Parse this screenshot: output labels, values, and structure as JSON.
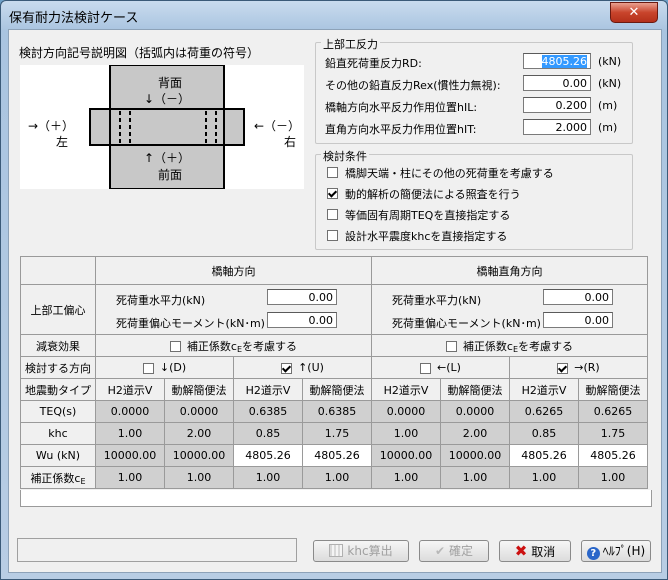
{
  "window": {
    "title": "保有耐力法検討ケース",
    "close_glyph": "✕"
  },
  "diagram": {
    "caption": "検討方向記号説明図（括弧内は荷重の符号）",
    "top_label": "背面",
    "top_arrow": "↓（－）",
    "bottom_arrow": "↑（＋）",
    "bottom_label": "前面",
    "left_arrow": "→（＋）",
    "left_label": "左",
    "right_arrow": "←（－）",
    "right_label": "右"
  },
  "reaction": {
    "title": "上部工反力",
    "rows": [
      {
        "label": "鉛直死荷重反力RD:",
        "value": "4805.26",
        "unit": "(kN)"
      },
      {
        "label": "その他の鉛直反力Rex(慣性力無視):",
        "value": "0.00",
        "unit": "(kN)"
      },
      {
        "label": "橋軸方向水平反力作用位置hIL:",
        "value": "0.200",
        "unit": "(m)"
      },
      {
        "label": "直角方向水平反力作用位置hIT:",
        "value": "2.000",
        "unit": "(m)"
      }
    ]
  },
  "conditions": {
    "title": "検討条件",
    "items": [
      {
        "label": "橋脚天端・柱にその他の死荷重を考慮する",
        "checked": false
      },
      {
        "label": "動的解析の簡便法による照査を行う",
        "checked": true
      },
      {
        "label": "等価固有周期TEQを直接指定する",
        "checked": false
      },
      {
        "label": "設計水平震度khcを直接指定する",
        "checked": false
      }
    ]
  },
  "grid": {
    "head_axis": "橋軸方向",
    "head_perp": "橋軸直角方向",
    "ecc_label": "上部工偏心",
    "ecc_h_label": "死荷重水平力(kN)",
    "ecc_m_label": "死荷重偏心モーメント(kN･m)",
    "ecc_axis_h": "0.00",
    "ecc_axis_m": "0.00",
    "ecc_perp_h": "0.00",
    "ecc_perp_m": "0.00",
    "damp_label": "減衰効果",
    "damp_axis_text": "補正係数c",
    "damp_perp_text": "補正係数c",
    "damp_sub": "E",
    "damp_suffix": "を考慮する",
    "dir_label": "検討する方向",
    "dirs": [
      {
        "label": "↓(D)",
        "checked": false
      },
      {
        "label": "↑(U)",
        "checked": true
      },
      {
        "label": "←(L)",
        "checked": false
      },
      {
        "label": "→(R)",
        "checked": true
      }
    ],
    "type_label": "地震動タイプ",
    "col_types": [
      "H2道示V",
      "動解簡便法",
      "H2道示V",
      "動解簡便法",
      "H2道示V",
      "動解簡便法",
      "H2道示V",
      "動解簡便法"
    ],
    "rows": [
      {
        "label": "TEQ(s)",
        "values": [
          "0.0000",
          "0.0000",
          "0.6385",
          "0.6385",
          "0.0000",
          "0.0000",
          "0.6265",
          "0.6265"
        ]
      },
      {
        "label": "khc",
        "values": [
          "1.00",
          "2.00",
          "0.85",
          "1.75",
          "1.00",
          "2.00",
          "0.85",
          "1.75"
        ]
      },
      {
        "label": "Wu (kN)",
        "values": [
          "10000.00",
          "10000.00",
          "4805.26",
          "4805.26",
          "10000.00",
          "10000.00",
          "4805.26",
          "4805.26"
        ]
      },
      {
        "label": "補正係数c",
        "label_sub": "E",
        "values": [
          "1.00",
          "1.00",
          "1.00",
          "1.00",
          "1.00",
          "1.00",
          "1.00",
          "1.00"
        ]
      }
    ]
  },
  "buttons": {
    "khc": "khc算出",
    "ok": "確定",
    "cancel": "取消",
    "help": "ﾍﾙﾌﾟ(H)"
  }
}
